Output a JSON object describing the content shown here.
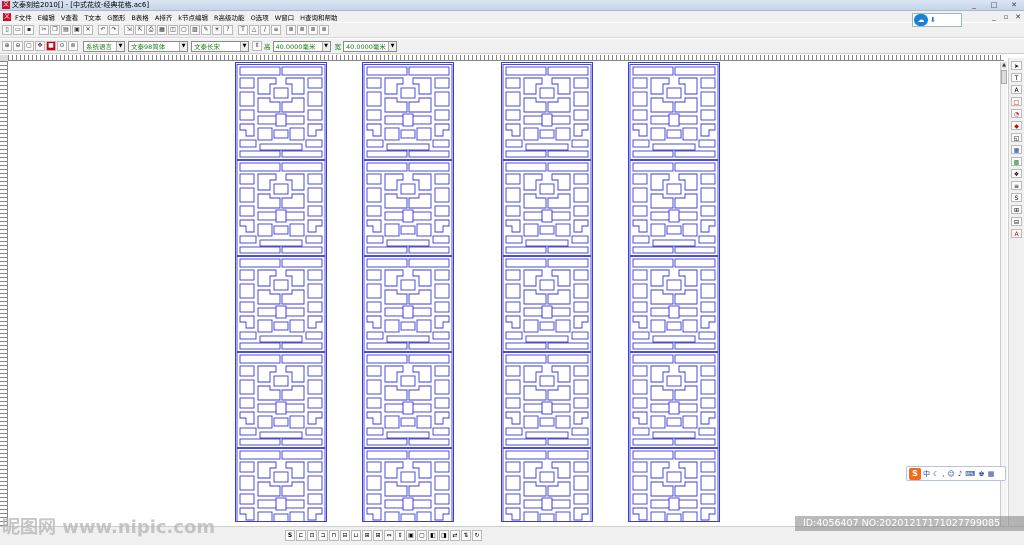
{
  "window": {
    "title": "文泰刻绘2010[] - [中式花纹-经典花格.ac6]",
    "controls": [
      "_",
      "□",
      "✕"
    ]
  },
  "menu": {
    "items": [
      "F文件",
      "E编辑",
      "V查看",
      "T文本",
      "G图形",
      "B表格",
      "A排齐",
      "k节点编辑",
      "R高级功能",
      "O选项",
      "W窗口",
      "H查询和帮助"
    ],
    "right_controls": [
      "_",
      "▫",
      "✕"
    ]
  },
  "toolbar2": {
    "language": "系统语言",
    "font_family": "文泰98简体",
    "font_style": "文泰长宋",
    "height_label": "高",
    "height_value": "40.0000毫米",
    "width_label": "宽",
    "width_value": "40.0000毫米"
  },
  "ime": {
    "logo": "S",
    "mode": "中"
  },
  "watermark": {
    "left": "昵图网 www.nipic.com",
    "right": "ID:4056407 NO:20201217171027799085"
  },
  "colors": {
    "pattern_stroke": "#3a3ad6",
    "accent_red": "#c8102e"
  },
  "panels": [
    "lattice-panel-1",
    "lattice-panel-2",
    "lattice-panel-3",
    "lattice-panel-4"
  ]
}
